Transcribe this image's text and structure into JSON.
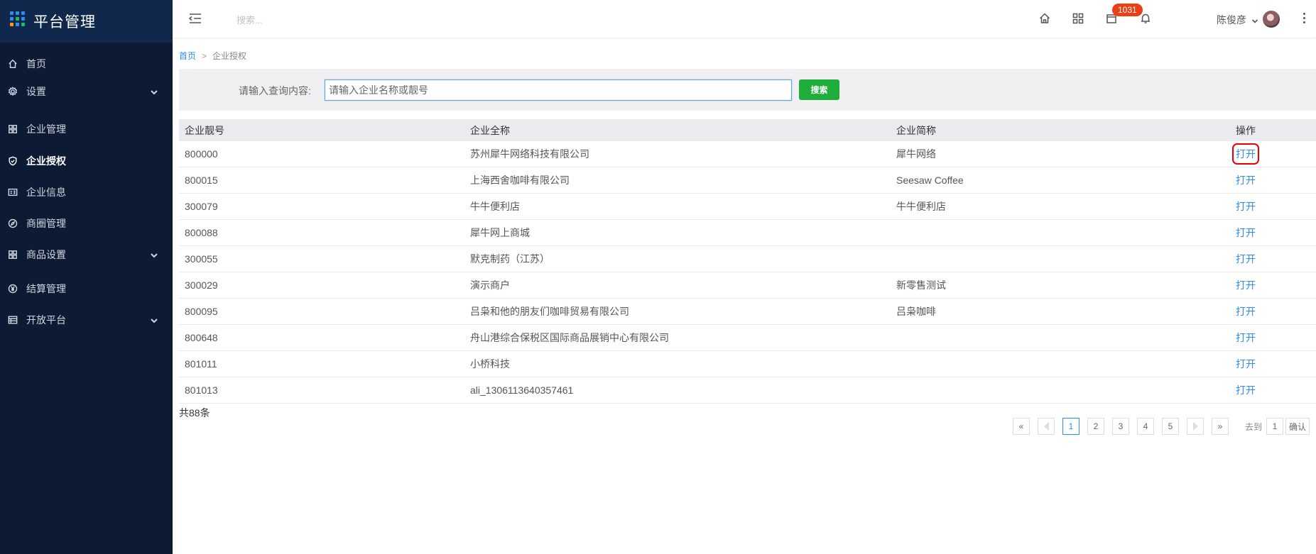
{
  "sidebar": {
    "title": "平台管理",
    "items": [
      {
        "label": "首页",
        "icon": "home-icon",
        "active": false
      },
      {
        "label": "设置",
        "icon": "gear-icon",
        "expandable": true
      },
      {
        "label": "企业管理",
        "icon": "cluster-icon"
      },
      {
        "label": "企业授权",
        "icon": "shield-icon",
        "active": true
      },
      {
        "label": "企业信息",
        "icon": "id-card-icon"
      },
      {
        "label": "商圈管理",
        "icon": "compass-icon"
      },
      {
        "label": "商品设置",
        "icon": "grid-icon",
        "expandable": true
      },
      {
        "label": "结算管理",
        "icon": "yen-icon"
      },
      {
        "label": "开放平台",
        "icon": "table-icon",
        "expandable": true
      }
    ]
  },
  "header": {
    "search_placeholder": "搜索...",
    "badge_count": "1031",
    "user_name": "陈俊彦"
  },
  "breadcrumb": {
    "home": "首页",
    "separator": ">",
    "current": "企业授权"
  },
  "search": {
    "label": "请输入查询内容:",
    "placeholder": "请输入企业名称或靓号",
    "button": "搜索"
  },
  "table": {
    "columns": [
      "企业靓号",
      "企业全称",
      "企业简称",
      "操作"
    ],
    "rows": [
      {
        "code": "800000",
        "full_name": "苏州犀牛网络科技有限公司",
        "short_name": "犀牛网络",
        "action": "打开"
      },
      {
        "code": "800015",
        "full_name": "上海西舍咖啡有限公司",
        "short_name": "Seesaw Coffee",
        "action": "打开"
      },
      {
        "code": "300079",
        "full_name": "牛牛便利店",
        "short_name": "牛牛便利店",
        "action": "打开"
      },
      {
        "code": "800088",
        "full_name": "犀牛网上商城",
        "short_name": "",
        "action": "打开"
      },
      {
        "code": "300055",
        "full_name": "默克制药（江苏）",
        "short_name": "",
        "action": "打开"
      },
      {
        "code": "300029",
        "full_name": "演示商户",
        "short_name": "新零售测试",
        "action": "打开"
      },
      {
        "code": "800095",
        "full_name": "吕枭和他的朋友们咖啡贸易有限公司",
        "short_name": "吕枭咖啡",
        "action": "打开"
      },
      {
        "code": "800648",
        "full_name": "舟山港综合保税区国际商品展销中心有限公司",
        "short_name": "",
        "action": "打开"
      },
      {
        "code": "801011",
        "full_name": "小桥科技",
        "short_name": "",
        "action": "打开"
      },
      {
        "code": "801013",
        "full_name": "ali_1306113640357461",
        "short_name": "",
        "action": "打开"
      }
    ]
  },
  "footer": {
    "total": "共88条",
    "pages": [
      "1",
      "2",
      "3",
      "4",
      "5"
    ],
    "current_page": "1",
    "first": "«",
    "last": "»",
    "goto_label": "去到",
    "goto_value": "1",
    "confirm": "确认"
  }
}
